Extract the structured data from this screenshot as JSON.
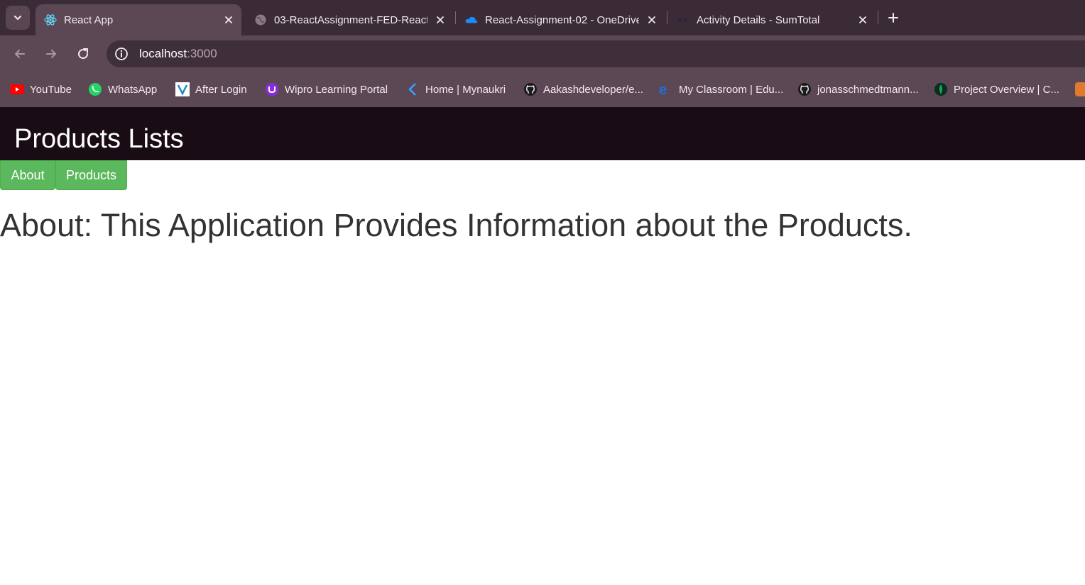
{
  "browser": {
    "tabs": [
      {
        "title": "React App",
        "icon": "react-icon",
        "active": true
      },
      {
        "title": "03-ReactAssignment-FED-React",
        "icon": "globe-icon",
        "active": false
      },
      {
        "title": "React-Assignment-02 - OneDrive",
        "icon": "onedrive-icon",
        "active": false
      },
      {
        "title": "Activity Details - SumTotal",
        "icon": "sumtotal-icon",
        "active": false
      }
    ],
    "address": {
      "host": "localhost",
      "port": ":3000"
    },
    "bookmarks": [
      {
        "label": "YouTube",
        "icon": "youtube-icon"
      },
      {
        "label": "WhatsApp",
        "icon": "whatsapp-icon"
      },
      {
        "label": "After Login",
        "icon": "v-logo-icon"
      },
      {
        "label": "Wipro Learning Portal",
        "icon": "wipro-icon"
      },
      {
        "label": "Home | Mynaukri",
        "icon": "mynaukri-icon"
      },
      {
        "label": "Aakashdeveloper/e...",
        "icon": "github-icon"
      },
      {
        "label": "My Classroom | Edu...",
        "icon": "edureka-icon"
      },
      {
        "label": "jonasschmedtmann...",
        "icon": "github-icon"
      },
      {
        "label": "Project Overview | C...",
        "icon": "mongodb-icon"
      }
    ]
  },
  "page": {
    "title": "Products Lists",
    "nav": {
      "about": "About",
      "products": "Products"
    },
    "about_text": "About: This Application Provides Information about the Products."
  },
  "colors": {
    "header_bg": "#1a0c14",
    "button_green": "#5cb85c",
    "browser_frame": "#5b4854"
  }
}
